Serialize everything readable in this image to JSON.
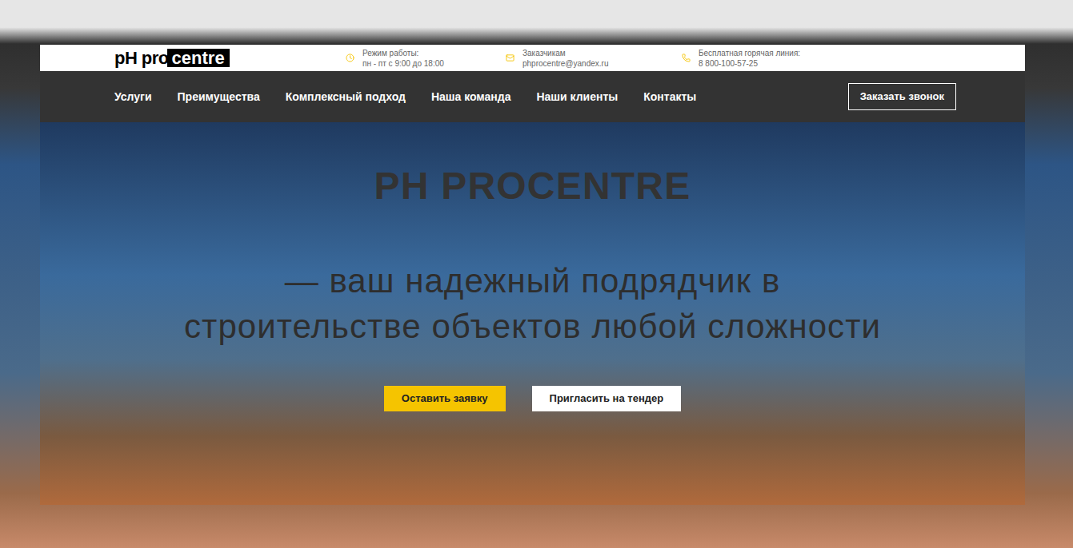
{
  "logo": {
    "left": "pH pro",
    "right": "centre"
  },
  "info": [
    {
      "kind": "clock",
      "label": "Режим работы:",
      "value": "пн - пт с 9:00 до 18:00"
    },
    {
      "kind": "mail",
      "label": "Заказчикам",
      "value": "phprocentre@yandex.ru"
    },
    {
      "kind": "phone",
      "label": "Бесплатная горячая линия:",
      "value": "8 800-100-57-25"
    }
  ],
  "nav": {
    "items": [
      "Услуги",
      "Преимущества",
      "Комплексный подход",
      "Наша команда",
      "Наши клиенты",
      "Контакты"
    ],
    "button": "Заказать звонок"
  },
  "hero": {
    "title": "PH PROCENTRE",
    "subtitle": "— ваш надежный подрядчик в строительстве объектов любой сложности",
    "buttons": [
      {
        "label": "Оставить заявку",
        "kind": "primary"
      },
      {
        "label": "Пригласить на тендер",
        "kind": "secondary"
      }
    ]
  }
}
